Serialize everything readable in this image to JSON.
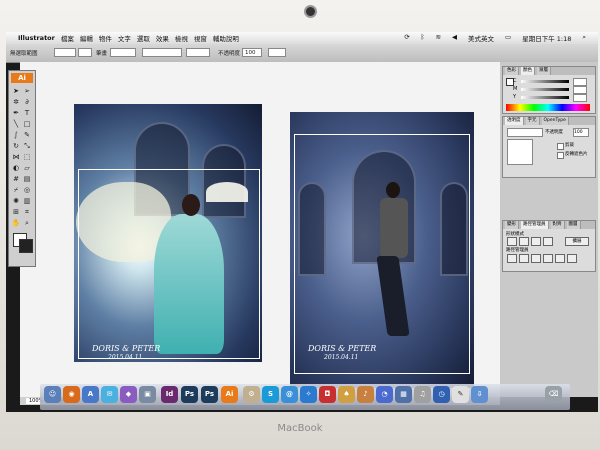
{
  "menubar": {
    "app_name": "Illustrator",
    "items": [
      "檔案",
      "編輯",
      "物件",
      "文字",
      "選取",
      "效果",
      "檢視",
      "視窗",
      "輔助說明"
    ],
    "input_method": "美式英文",
    "clock": "星期日下午 1:18"
  },
  "toolbar": {
    "selection_label": "無選取範圍",
    "stroke_label": "筆畫",
    "opacity_label": "不透明度",
    "opacity_value": "100"
  },
  "tools_panel": {
    "badge": "Ai"
  },
  "artboard1": {
    "signature": "DORIS & PETER",
    "date": "2015.04.11"
  },
  "artboard2": {
    "signature": "DORIS & PETER",
    "date": "2015.04.11"
  },
  "panels": {
    "color_tabs": [
      "色彩",
      "顏色",
      "漸層"
    ],
    "transparency_tabs": [
      "透明度",
      "字元",
      "OpenType"
    ],
    "transparency_opacity_label": "不透明度",
    "transparency_opacity_value": "100",
    "option_1": "剪裁",
    "option_2": "反轉遮色片",
    "pathfinder_tabs": [
      "變形",
      "路徑管理員",
      "對齊",
      "圖層"
    ],
    "shape_modes_label": "形狀模式",
    "expand_button": "擴展",
    "pathfinder_label": "路徑管理員"
  },
  "statusbar": {
    "zoom": "100%",
    "info": "畫框"
  },
  "dock_icons": [
    {
      "label": "Id",
      "color": "#6b2a6e"
    },
    {
      "label": "Ps",
      "color": "#1d3b5a"
    },
    {
      "label": "Ps",
      "color": "#1d3b5a"
    },
    {
      "label": "Ai",
      "color": "#e87a17"
    }
  ],
  "brand": "MacBook"
}
